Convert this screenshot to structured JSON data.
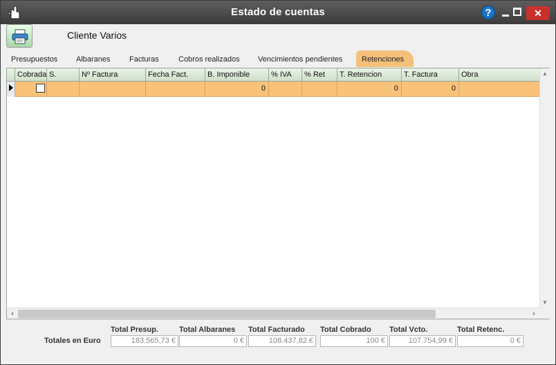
{
  "window": {
    "title": "Estado de cuentas",
    "help_label": "?",
    "close_label": "✕"
  },
  "client": {
    "name": "Cliente Varios"
  },
  "tabs": [
    {
      "label": "Presupuestos",
      "active": false
    },
    {
      "label": "Albaranes",
      "active": false
    },
    {
      "label": "Facturas",
      "active": false
    },
    {
      "label": "Cobros realizados",
      "active": false
    },
    {
      "label": "Vencimientos pendientes",
      "active": false
    },
    {
      "label": "Retenciones",
      "active": true
    }
  ],
  "grid": {
    "columns": [
      "Cobrada",
      "S.",
      "Nº Factura",
      "Fecha Fact.",
      "B. Imponible",
      "% IVA",
      "% Ret",
      "T. Retencion",
      "T. Factura",
      "Obra"
    ],
    "rows": [
      {
        "cobrada": false,
        "s": "",
        "n_factura": "",
        "fecha_fact": "",
        "b_imponible": "0",
        "iva": "",
        "ret": "",
        "t_retencion": "0",
        "t_factura": "0",
        "obra": ""
      }
    ]
  },
  "totals": {
    "row_label": "Totales en Euro",
    "items": [
      {
        "label": "Total Presup.",
        "value": "183.565,73 €"
      },
      {
        "label": "Total Albaranes",
        "value": "0 €"
      },
      {
        "label": "Total Facturado",
        "value": "108.437,82 €"
      },
      {
        "label": "Total Cobrado",
        "value": "100 €"
      },
      {
        "label": "Total Vcto.",
        "value": "107.754,99 €"
      },
      {
        "label": "Total Retenc.",
        "value": "0 €"
      }
    ]
  },
  "colors": {
    "active_tab": "#f5c07a",
    "selected_row": "#f9c27a",
    "header_green": "#cfdfca",
    "close_button": "#c9302c"
  }
}
